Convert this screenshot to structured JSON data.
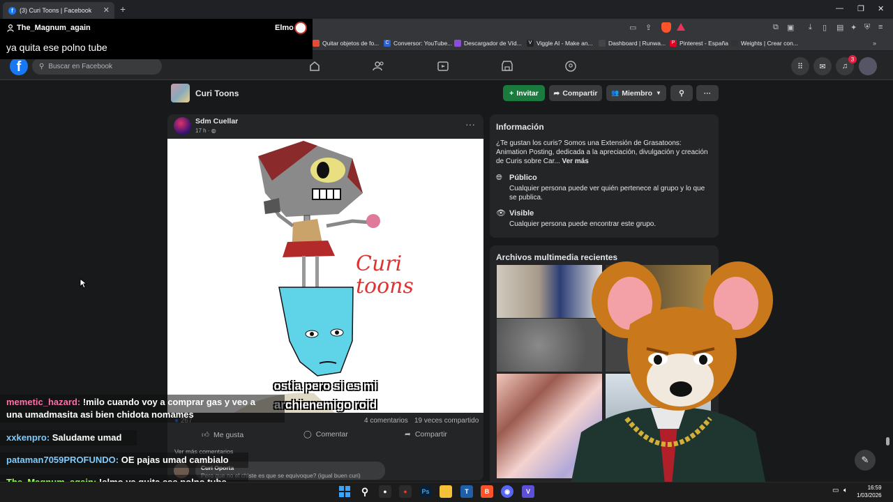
{
  "browser": {
    "tab_title": "(3) Curi Toons | Facebook",
    "bookmarks": [
      {
        "label": "Quitar objetos de fo...",
        "color": "#e04e39",
        "glyph": ""
      },
      {
        "label": "Conversor: YouTube...",
        "color": "#2a63d4",
        "glyph": "C"
      },
      {
        "label": "Descargador de Víd...",
        "color": "#8a4fd8",
        "glyph": ""
      },
      {
        "label": "Viggle AI - Make an...",
        "color": "#222222",
        "glyph": "V"
      },
      {
        "label": "Dashboard | Runwa...",
        "color": "#444444",
        "glyph": ""
      },
      {
        "label": "Pinterest - España",
        "color": "#e60023",
        "glyph": "P"
      },
      {
        "label": "Weights | Crear con...",
        "color": "#333333",
        "glyph": ""
      }
    ]
  },
  "overlay": {
    "username": "The_Magnum_again",
    "redeem": "Elmo",
    "message": "ya quita ese polno tube"
  },
  "facebook": {
    "search_placeholder": "Buscar en Facebook",
    "notification_count": "3",
    "group": {
      "name": "Curi Toons",
      "invite": "Invitar",
      "share": "Compartir",
      "member": "Miembro"
    },
    "post": {
      "author": "Sdm Cuellar",
      "time": "17 h ·",
      "image_text": "Curi toons",
      "caption_line1": "ostia pero si es mi",
      "caption_line2": "archienemigo roid",
      "reactions": "267",
      "comments": "4 comentarios",
      "shares": "19 veces compartido",
      "like": "Me gusta",
      "comment": "Comentar",
      "share": "Compartir",
      "more_comments": "Ver más comentarios",
      "peek_author": "Curi Oporta",
      "peek_text": "Pero que no el chiste es que se equivoque? (igual buen curi)"
    },
    "info": {
      "title": "Información",
      "description": "¿Te gustan los curis? Somos una Extensión de Grasatoons: Animation Posting, dedicada a la apreciación, divulgación y creación de Curis sobre Car...",
      "see_more": "Ver más",
      "public_title": "Público",
      "public_text": "Cualquier persona puede ver quién pertenece al grupo y lo que se publica.",
      "visible_title": "Visible",
      "visible_text": "Cualquier persona puede encontrar este grupo."
    },
    "media_title": "Archivos multimedia recientes"
  },
  "chat": [
    {
      "user": "memetic_hazard",
      "color": "#ff6fa8",
      "text": "!milo cuando voy a comprar gas y veo a",
      "cont": "una umadmasita asi bien chidota nomames"
    },
    {
      "user": "xxkenpro",
      "color": "#7ecbff",
      "text": "Saludame umad"
    },
    {
      "user": "pataman7059PROFUNDO",
      "color": "#7ecbff",
      "text": "OE pajas umad cambialo"
    },
    {
      "user": "The_Magnum_again",
      "color": "#9cff57",
      "text": "!elmo ya quita ese polno tube"
    }
  ],
  "taskbar": {
    "time": "16:59",
    "date": "1/03/2026"
  }
}
